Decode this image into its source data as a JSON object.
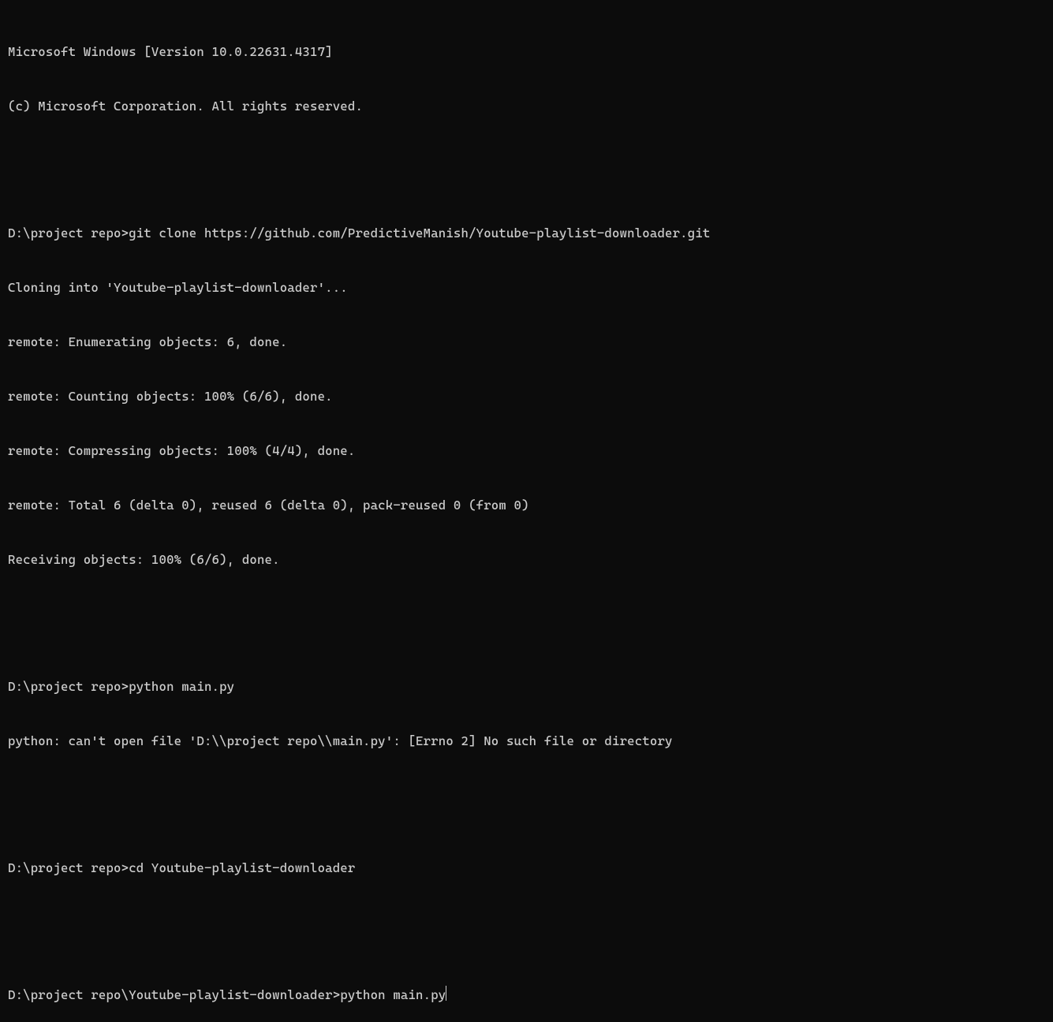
{
  "header": {
    "version_line": "Microsoft Windows [Version 10.0.22631.4317]",
    "copyright_line": "(c) Microsoft Corporation. All rights reserved."
  },
  "blocks": [
    {
      "prompt": "D:\\project repo>",
      "command": "git clone https://github.com/PredictiveManish/Youtube-playlist-downloader.git",
      "output": [
        "Cloning into 'Youtube-playlist-downloader'...",
        "remote: Enumerating objects: 6, done.",
        "remote: Counting objects: 100% (6/6), done.",
        "remote: Compressing objects: 100% (4/4), done.",
        "remote: Total 6 (delta 0), reused 6 (delta 0), pack-reused 0 (from 0)",
        "Receiving objects: 100% (6/6), done."
      ]
    },
    {
      "prompt": "D:\\project repo>",
      "command": "python main.py",
      "output": [
        "python: can't open file 'D:\\\\project repo\\\\main.py': [Errno 2] No such file or directory"
      ]
    },
    {
      "prompt": "D:\\project repo>",
      "command": "cd Youtube-playlist-downloader",
      "output": []
    }
  ],
  "current": {
    "prompt": "D:\\project repo\\Youtube-playlist-downloader>",
    "command": "python main.py"
  }
}
